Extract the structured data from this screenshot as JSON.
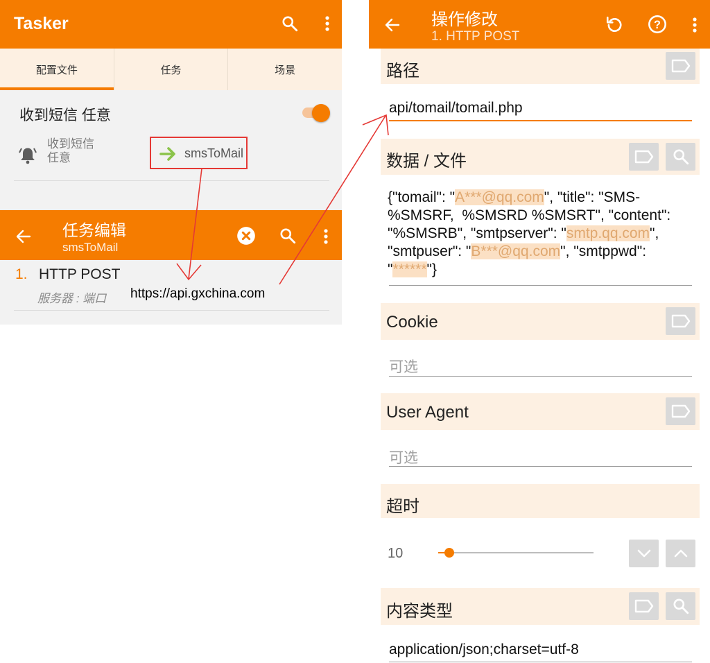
{
  "left": {
    "app_title": "Tasker",
    "tabs": [
      {
        "label": "配置文件",
        "active": true
      },
      {
        "label": "任务",
        "active": false
      },
      {
        "label": "场景",
        "active": false
      }
    ],
    "profile": {
      "name": "收到短信 任意",
      "enabled": true,
      "context_line1": "收到短信",
      "context_line2": "任意",
      "task_name": "smsToMail"
    },
    "task_edit": {
      "title": "任务编辑",
      "subtitle": "smsToMail",
      "action_number": "1.",
      "action_name": "HTTP POST",
      "action_detail": "服务器 : 端口",
      "action_url": "https://api.gxchina.com"
    }
  },
  "right": {
    "title": "操作修改",
    "subtitle": "1. HTTP POST",
    "path": {
      "label": "路径",
      "value": "api/tomail/tomail.php"
    },
    "data": {
      "label": "数据 / 文件",
      "parts": [
        {
          "text": "{\"tomail\": \""
        },
        {
          "text": "A***@qq.com",
          "highlight": true
        },
        {
          "text": "\", \"title\": \"SMS-%SMSRF,  %SMSRD %SMSRT\", \"content\": \"%SMSRB\", \"smtpserver\": \""
        },
        {
          "text": "smtp.qq.com",
          "highlight": true
        },
        {
          "text": "\", \"smtpuser\": \""
        },
        {
          "text": "B***@qq.com",
          "highlight": true
        },
        {
          "text": "\", \"smtppwd\": \""
        },
        {
          "text": "******",
          "highlight": true
        },
        {
          "text": "\"}"
        }
      ]
    },
    "cookie": {
      "label": "Cookie",
      "placeholder": "可选"
    },
    "user_agent": {
      "label": "User Agent",
      "placeholder": "可选"
    },
    "timeout": {
      "label": "超时",
      "value": "10",
      "slider_fraction": 0.07
    },
    "content_type": {
      "label": "内容类型",
      "value": "application/json;charset=utf-8"
    }
  },
  "colors": {
    "accent": "#f57c00",
    "section_bg": "#fdf0e2",
    "annotation": "#e53935",
    "highlight_bg": "#fbe0c4"
  }
}
